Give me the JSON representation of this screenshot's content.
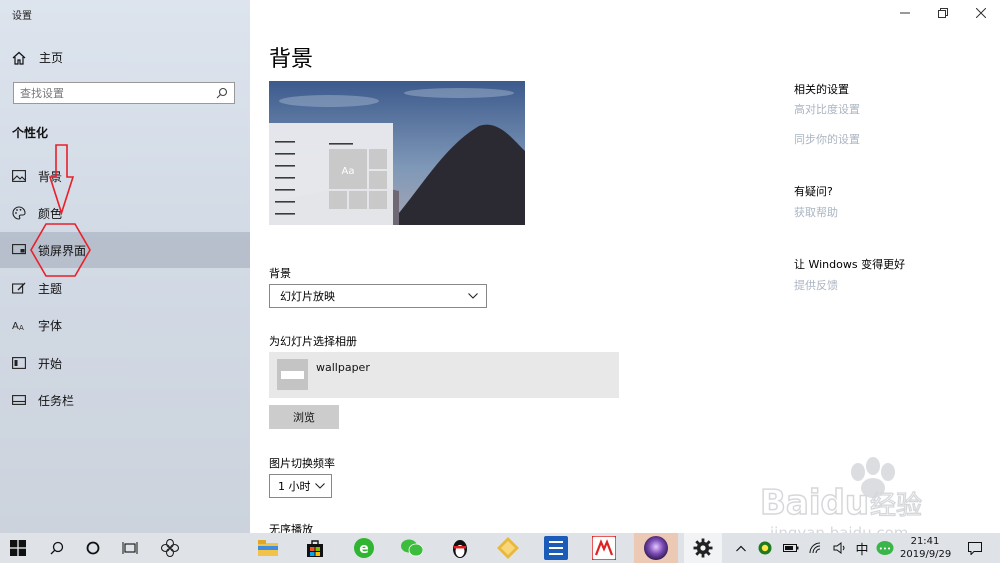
{
  "window": {
    "title": "设置"
  },
  "sidebar": {
    "home_label": "主页",
    "search_placeholder": "查找设置",
    "section_title": "个性化",
    "items": [
      {
        "label": "背景",
        "icon": "picture-icon"
      },
      {
        "label": "颜色",
        "icon": "palette-icon"
      },
      {
        "label": "锁屏界面",
        "icon": "lock-screen-icon",
        "active": true
      },
      {
        "label": "主题",
        "icon": "theme-brush-icon"
      },
      {
        "label": "字体",
        "icon": "font-icon"
      },
      {
        "label": "开始",
        "icon": "start-menu-icon"
      },
      {
        "label": "任务栏",
        "icon": "taskbar-icon"
      }
    ]
  },
  "main": {
    "title": "背景",
    "preview": {
      "sample_text": "Aa"
    },
    "background_label": "背景",
    "background_value": "幻灯片放映",
    "album_label": "为幻灯片选择相册",
    "album_name": "wallpaper",
    "browse_label": "浏览",
    "interval_label": "图片切换频率",
    "interval_value": "1 小时",
    "shuffle_label": "无序播放"
  },
  "related": {
    "title": "相关的设置",
    "links": [
      "高对比度设置",
      "同步你的设置"
    ],
    "question_title": "有疑问?",
    "help_link": "获取帮助",
    "improve_title": "让 Windows 变得更好",
    "feedback_link": "提供反馈"
  },
  "taskbar": {
    "ime": "中",
    "time": "21:41",
    "date": "2019/9/29"
  },
  "colors": {
    "sidebar_bg": "#d3dbe6",
    "annotation_red": "#e8202a",
    "link_muted": "#aab4c2",
    "taskbar_bg": "#dfe3e8"
  }
}
